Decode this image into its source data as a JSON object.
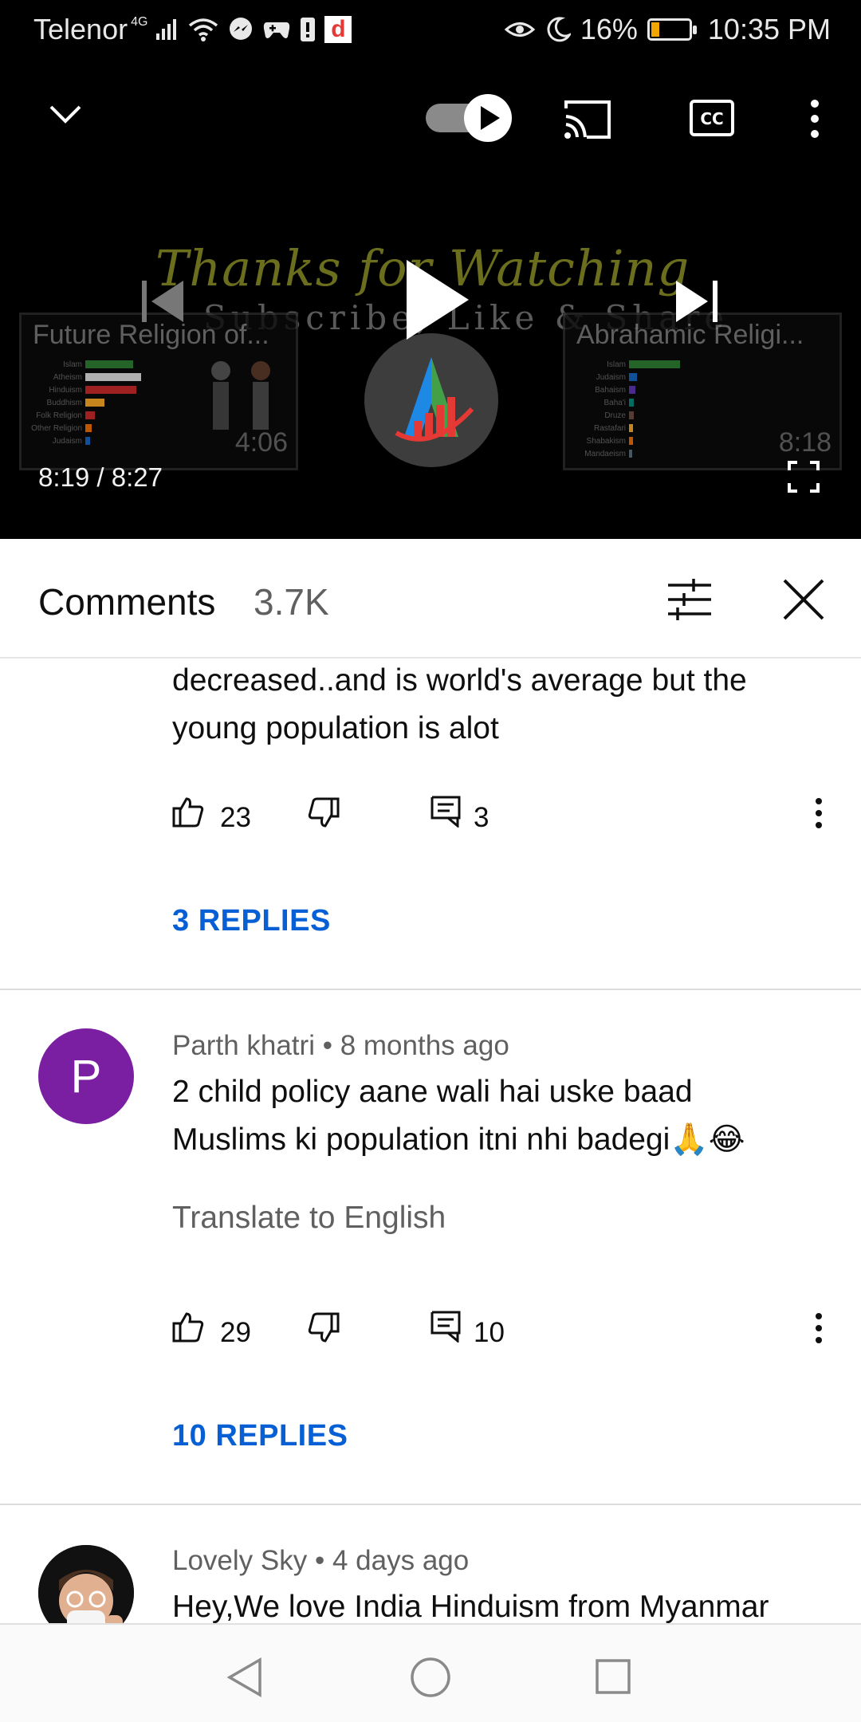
{
  "status_bar": {
    "carrier": "Telenor",
    "network": "4G",
    "battery_percent": "16%",
    "time": "10:35 PM",
    "battery_level": 0.16,
    "battery_color": "#f2a400"
  },
  "player": {
    "end_screen_title": "Thanks for Watching",
    "end_screen_subtitle": "Subscribe, Like & Share",
    "left_card": {
      "title": "Future Religion of...",
      "duration": "4:06",
      "rows": [
        "Islam",
        "Atheism",
        "Hinduism",
        "Buddhism",
        "Folk Religion",
        "Other Religion",
        "Judaism"
      ]
    },
    "right_card": {
      "title": "Abrahamic Religi...",
      "duration": "8:18",
      "rows": [
        "Islam",
        "Judaism",
        "Bahaism",
        "Baha'i",
        "Druze",
        "Rastafari",
        "Shabakism",
        "Mandaeism"
      ]
    },
    "current_time": "8:19",
    "separator": "/",
    "total_time": "8:27",
    "progress": 0.984,
    "progress_color": "#e62117",
    "autoplay": true
  },
  "comments": {
    "title": "Comments",
    "count": "3.7K",
    "items": [
      {
        "text_line1": "decreased..and is world's average but the",
        "text_line2": "young population is alot",
        "likes": "23",
        "replies_count": "3",
        "replies_label": "3 REPLIES"
      },
      {
        "avatar_letter": "P",
        "author": "Parth khatri",
        "age": "8 months ago",
        "dot": "•",
        "text_line1": "2 child policy aane wali hai uske baad",
        "text_line2": "Muslims ki population itni nhi badegi🙏😂",
        "translate": "Translate to English",
        "likes": "29",
        "replies_count": "10",
        "replies_label": "10 REPLIES"
      },
      {
        "author": "Lovely Sky",
        "age": "4 days ago",
        "dot": "•",
        "text_line1": "Hey,We love India Hinduism from Myanmar"
      }
    ],
    "link_color": "#065fd4",
    "avatar_color": "#7b1fa2"
  }
}
